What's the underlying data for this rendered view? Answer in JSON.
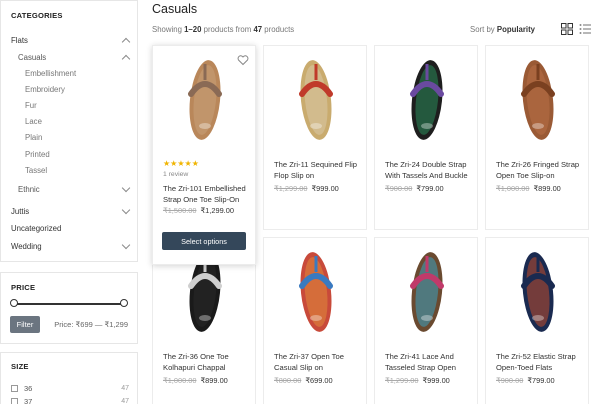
{
  "sidebar": {
    "categories_title": "CATEGORIES",
    "categories": [
      {
        "label": "Flats",
        "level": 0,
        "chevron": "up"
      },
      {
        "label": "Casuals",
        "level": 1,
        "chevron": "up"
      },
      {
        "label": "Embellishment",
        "level": 2
      },
      {
        "label": "Embroidery",
        "level": 2
      },
      {
        "label": "Fur",
        "level": 2
      },
      {
        "label": "Lace",
        "level": 2
      },
      {
        "label": "Plain",
        "level": 2
      },
      {
        "label": "Printed",
        "level": 2
      },
      {
        "label": "Tassel",
        "level": 2
      },
      {
        "label": "Ethnic",
        "level": 1,
        "chevron": "down"
      },
      {
        "label": "Juttis",
        "level": 0,
        "chevron": "down"
      },
      {
        "label": "Uncategorized",
        "level": 0
      },
      {
        "label": "Wedding",
        "level": 0,
        "chevron": "down"
      }
    ],
    "price_title": "PRICE",
    "filter_label": "Filter",
    "price_range_text": "Price: ₹699 — ₹1,299",
    "size_title": "SIZE",
    "sizes": [
      {
        "label": "36",
        "count": "47"
      },
      {
        "label": "37",
        "count": "47"
      }
    ]
  },
  "main": {
    "title": "Casuals",
    "showing_prefix": "Showing ",
    "showing_range": "1–20",
    "showing_mid": " products from ",
    "showing_total": "47",
    "showing_suffix": " products",
    "sort_prefix": "Sort by ",
    "sort_value": "Popularity",
    "products": [
      {
        "name": "The Zri-101 Embellished Strap One Toe Slip-On",
        "old_price": "₹1,500.00",
        "new_price": "₹1,299.00",
        "rating_stars": "★★★★★",
        "reviews": "1 review",
        "button": "Select options",
        "sandal_color": "#b9875a",
        "strap_color": "#c8a07a",
        "accent": "#8a6a55"
      },
      {
        "name": "The Zri-11 Sequined Flip Flop Slip on",
        "old_price": "₹1,299.00",
        "new_price": "₹999.00",
        "sandal_color": "#c9ab6e",
        "strap_color": "#d8c8a8",
        "accent": "#c03a2a"
      },
      {
        "name": "The Zri-24 Double Strap With Tassels And Buckle",
        "old_price": "₹900.00",
        "new_price": "₹799.00",
        "sandal_color": "#1e1e1e",
        "strap_color": "#2a8a5a",
        "accent": "#6a4aa0"
      },
      {
        "name": "The Zri-26 Fringed Strap Open Toe Slip-on",
        "old_price": "₹1,000.00",
        "new_price": "₹899.00",
        "sandal_color": "#9a5a35",
        "strap_color": "#b87045",
        "accent": "#7a4020"
      },
      {
        "name": "The Zri-36 One Toe Kolhapuri Chappal",
        "old_price": "₹1,000.00",
        "new_price": "₹899.00",
        "sandal_color": "#1a1a1a",
        "strap_color": "#2a2a2a",
        "accent": "#cfcfcf"
      },
      {
        "name": "The Zri-37 Open Toe Casual Slip on",
        "old_price": "₹800.00",
        "new_price": "₹699.00",
        "sandal_color": "#c84a3a",
        "strap_color": "#e08a3a",
        "accent": "#3a7ac0"
      },
      {
        "name": "The Zri-41 Lace And Tasseled Strap Open",
        "old_price": "₹1,299.00",
        "new_price": "₹999.00",
        "sandal_color": "#6a4a30",
        "strap_color": "#3aa0c0",
        "accent": "#c03a6a"
      },
      {
        "name": "The Zri-52 Elastic Strap Open-Toed Flats",
        "old_price": "₹900.00",
        "new_price": "₹799.00",
        "sandal_color": "#1a2a50",
        "strap_color": "#c04a2a",
        "accent": "#1a2a50"
      }
    ]
  }
}
